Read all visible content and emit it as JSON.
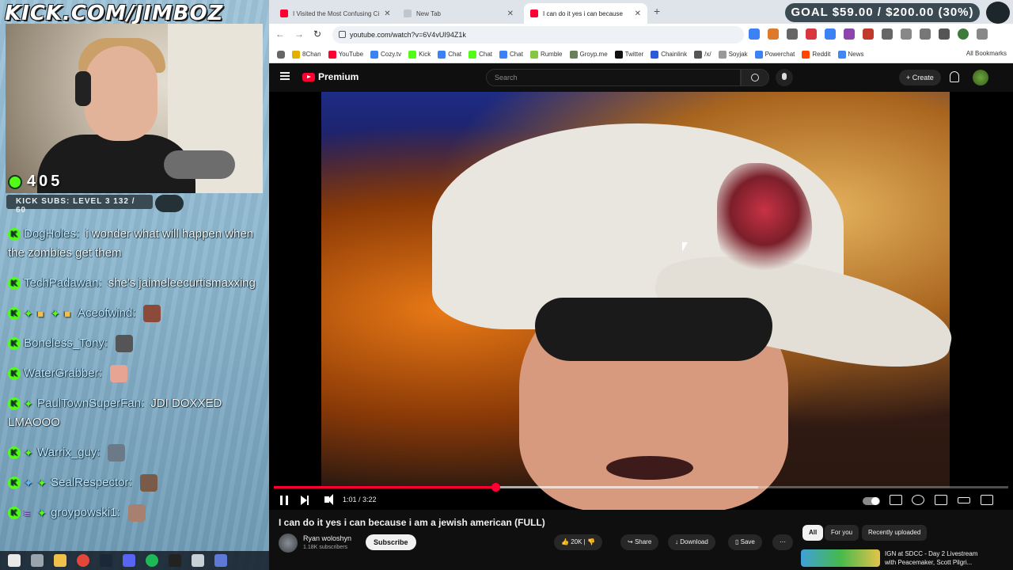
{
  "overlay": {
    "brand": "KICK.COM/JIMBOZ",
    "viewer_count": "405",
    "subs_label": "KICK SUBS: LEVEL 3 132 / 60",
    "goal": "GOAL $59.00 / $200.00 (30%)"
  },
  "chat": {
    "messages": [
      {
        "user": "DogHoles:",
        "text": "i wonder what will happen when the zombies get them"
      },
      {
        "user": "TechPadawan:",
        "text": "she's jaimeleecurtismaxxing"
      },
      {
        "user": "Aceofwind:",
        "text": ""
      },
      {
        "user": "Boneless_Tony:",
        "text": ""
      },
      {
        "user": "WaterGrabber:",
        "text": ""
      },
      {
        "user": "PaulTownSuperFan:",
        "text": "JDI DOXXED LMAOOO"
      },
      {
        "user": "Warrix_guy:",
        "text": ""
      },
      {
        "user": "SealRespector:",
        "text": ""
      },
      {
        "user": "groypowski1:",
        "text": ""
      }
    ]
  },
  "browser": {
    "tabs": [
      {
        "title": "I Visited the Most Confusing Ci",
        "active": false
      },
      {
        "title": "New Tab",
        "active": false
      },
      {
        "title": "I can do it yes i can because",
        "active": true
      }
    ],
    "url": "youtube.com/watch?v=6V4vUI94Z1k",
    "bookmarks": [
      "8Chan",
      "YouTube",
      "Cozy.tv",
      "Kick",
      "Chat",
      "Chat",
      "Chat",
      "Rumble",
      "Groyp.me",
      "Twitter",
      "Chainlink",
      "/x/",
      "Soyjak",
      "Powerchat",
      "Reddit",
      "News"
    ],
    "all_bookmarks": "All Bookmarks"
  },
  "youtube": {
    "logo_text": "Premium",
    "search_placeholder": "Search",
    "create_label": "Create",
    "player": {
      "current_time": "1:01",
      "duration": "3:22",
      "progress_fraction": 0.302,
      "buffered_fraction": 0.66
    },
    "video_title": "I can do it yes i can because i am a jewish american (FULL)",
    "channel": {
      "name": "Ryan woloshyn",
      "subscribers": "1.18K subscribers"
    },
    "subscribe_label": "Subscribe",
    "actions": {
      "likes": "20K",
      "share": "Share",
      "download": "Download",
      "save": "Save"
    },
    "chips": [
      "All",
      "For you",
      "Recently uploaded"
    ],
    "recommended": {
      "title": "IGN at SDCC - Day 2 Livestream with Peacemaker, Scott Pilgri..."
    }
  },
  "colors": {
    "kick_green": "#53fc18",
    "yt_red": "#ff0033",
    "overlay_bg": "#8db7cf"
  }
}
